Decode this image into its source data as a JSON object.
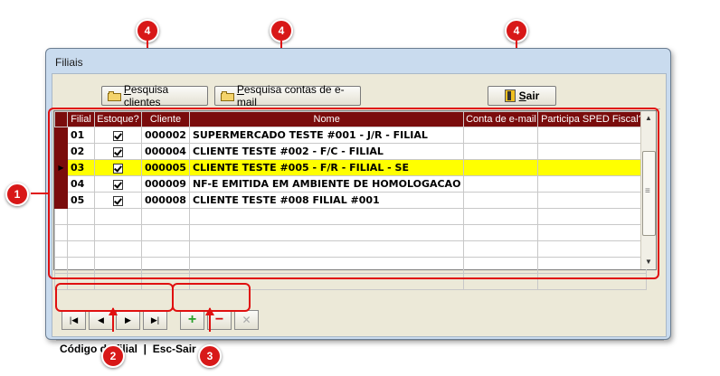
{
  "window": {
    "title": "Filiais"
  },
  "toolbar": {
    "pesquisa_clientes": "Pesquisa clientes",
    "pesquisa_email": "Pesquisa contas de e-mail",
    "sair": "Sair"
  },
  "grid": {
    "columns": [
      "Filial",
      "Estoque?",
      "Cliente",
      "Nome",
      "Conta de e-mail",
      "Participa SPED Fiscal?"
    ],
    "rows": [
      {
        "filial": "01",
        "estoque": true,
        "cliente": "000002",
        "nome": "SUPERMERCADO TESTE #001 - J/R - FILIAL",
        "email": "",
        "sped": ""
      },
      {
        "filial": "02",
        "estoque": true,
        "cliente": "000004",
        "nome": "CLIENTE TESTE #002 - F/C - FILIAL",
        "email": "",
        "sped": ""
      },
      {
        "filial": "03",
        "estoque": true,
        "cliente": "000005",
        "nome": "CLIENTE TESTE #005 - F/R - FILIAL - SE",
        "email": "",
        "sped": "",
        "selected": true
      },
      {
        "filial": "04",
        "estoque": true,
        "cliente": "000009",
        "nome": "NF-E EMITIDA EM AMBIENTE DE HOMOLOGACAO",
        "email": "",
        "sped": ""
      },
      {
        "filial": "05",
        "estoque": true,
        "cliente": "000008",
        "nome": "CLIENTE TESTE #008 FILIAL #001",
        "email": "",
        "sped": ""
      }
    ],
    "header_color": "#7a0c0c",
    "selected_color": "#ffff00"
  },
  "navigation": {
    "buttons": [
      "first-icon",
      "prior-icon",
      "next-icon",
      "last-icon"
    ],
    "crud": [
      "insert-icon",
      "delete-icon",
      "cancel-icon"
    ]
  },
  "status": {
    "text": "Código da filial  |  Esc-Sair"
  },
  "annotations": {
    "badges": [
      "4",
      "4",
      "4",
      "1",
      "2",
      "3"
    ],
    "color": "#d81818"
  }
}
